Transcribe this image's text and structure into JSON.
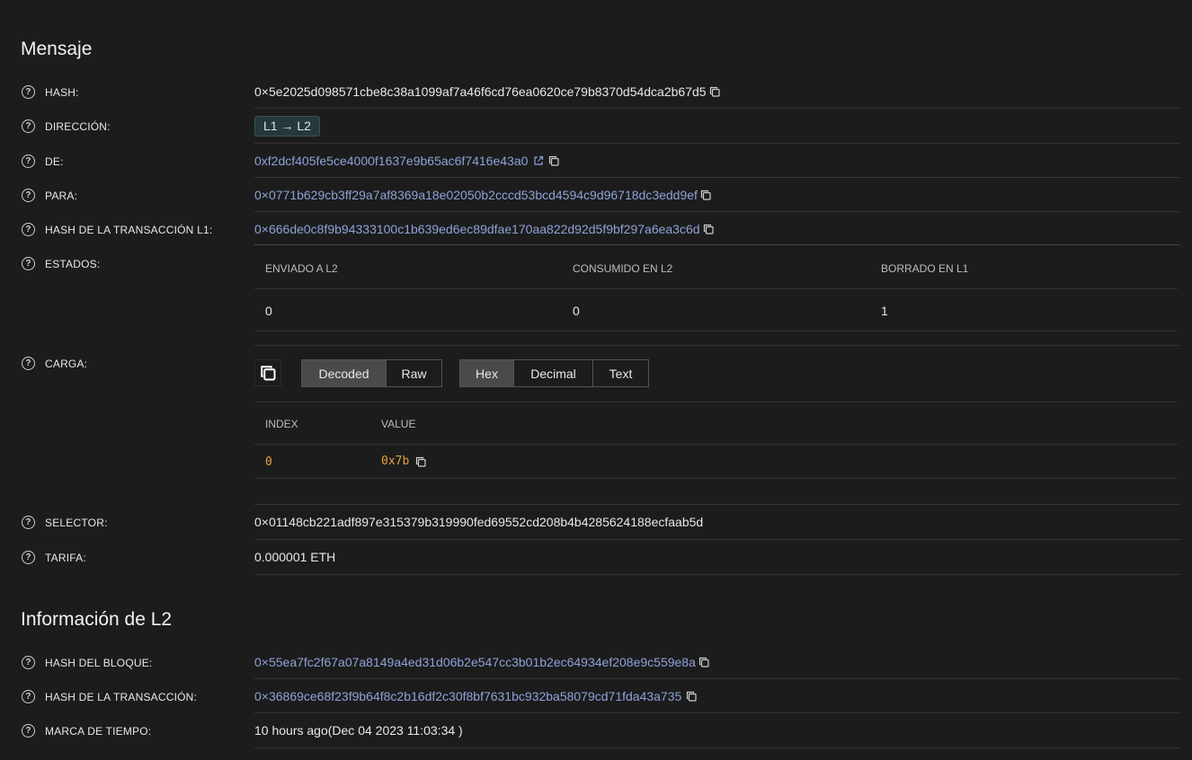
{
  "sections": {
    "message_title": "Mensaje",
    "l2_title": "Información de L2"
  },
  "message": {
    "hash": {
      "label": "HASH:",
      "value": "0×5e2025d098571cbe8c38a1099af7a46f6cd76ea0620ce79b8370d54dca2b67d5"
    },
    "direction": {
      "label": "DIRECCIÓN:",
      "value": "L1 → L2"
    },
    "from": {
      "label": "DE:",
      "value": "0xf2dcf405fe5ce4000f1637e9b65ac6f7416e43a0"
    },
    "to": {
      "label": "PARA:",
      "value": "0×0771b629cb3ff29a7af8369a18e02050b2cccd53bcd4594c9d96718dc3edd9ef"
    },
    "l1_tx_hash": {
      "label": "HASH DE LA TRANSACCIÓN L1:",
      "value": "0×666de0c8f9b94333100c1b639ed6ec89dfae170aa822d92d5f9bf297a6ea3c6d"
    },
    "states": {
      "label": "ESTADOS:",
      "headers": [
        "ENVIADO A L2",
        "CONSUMIDO EN L2",
        "BORRADO EN L1"
      ],
      "values": [
        "0",
        "0",
        "1"
      ]
    },
    "payload": {
      "label": "CARGA:",
      "view_modes": [
        "Decoded",
        "Raw"
      ],
      "active_view": "Decoded",
      "formats": [
        "Hex",
        "Decimal",
        "Text"
      ],
      "active_format": "Hex",
      "headers": [
        "INDEX",
        "VALUE"
      ],
      "rows": [
        {
          "index": "0",
          "value": "0x7b"
        }
      ]
    },
    "selector": {
      "label": "SELECTOR:",
      "value": "0×01148cb221adf897e315379b319990fed69552cd208b4b4285624188ecfaab5d"
    },
    "fee": {
      "label": "TARIFA:",
      "value": "0.000001 ETH"
    }
  },
  "l2": {
    "block_hash": {
      "label": "HASH DEL BLOQUE:",
      "value": "0×55ea7fc2f67a07a8149a4ed31d06b2e547cc3b01b2ec64934ef208e9c559e8a"
    },
    "tx_hash": {
      "label": "HASH DE LA TRANSACCIÓN:",
      "value": "0×36869ce68f23f9b64f8c2b16df2c30f8bf7631bc932ba58079cd71fda43a735"
    },
    "timestamp": {
      "label": "MARCA DE TIEMPO:",
      "relative": "10 hours ago",
      "absolute": "Dec 04 2023 11:03:34"
    }
  },
  "icons": {
    "help": "question-circle-icon",
    "copy": "copy-icon",
    "external": "external-link-icon"
  },
  "colors": {
    "background": "#1c1c1c",
    "link": "#8ea2d8",
    "badge_bg": "#26383d",
    "mono_value": "#e0a23a"
  }
}
